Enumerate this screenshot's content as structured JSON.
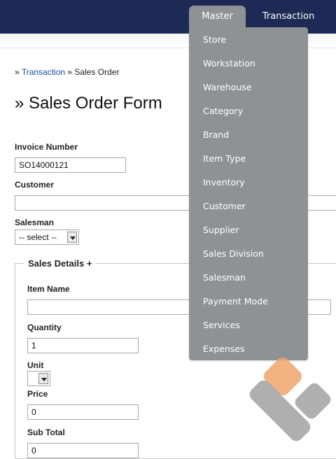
{
  "nav": {
    "master": "Master",
    "transaction": "Transaction"
  },
  "breadcrumb": {
    "sep": "»",
    "link": "Transaction",
    "current": "» Sales Order"
  },
  "page_title": "» Sales Order Form",
  "form": {
    "invoice_label": "Invoice Number",
    "invoice_value": "SO14000121",
    "customer_label": "Customer",
    "customer_value": "",
    "salesman_label": "Salesman",
    "salesman_selected": "-- select --"
  },
  "details": {
    "legend": "Sales Details +",
    "item_name_label": "Item Name",
    "item_name_value": "",
    "quantity_label": "Quantity",
    "quantity_value": "1",
    "unit_label": "Unit",
    "unit_selected": "",
    "price_label": "Price",
    "price_value": "0",
    "subtotal_label": "Sub Total",
    "subtotal_value": "0"
  },
  "master_menu": {
    "items": [
      "Store",
      "Workstation",
      "Warehouse",
      "Category",
      "Brand",
      "Item Type",
      "Inventory",
      "Customer",
      "Supplier",
      "Sales Division",
      "Salesman",
      "Payment Mode",
      "Services",
      "Expenses"
    ]
  },
  "colors": {
    "topbar": "#1c2a55",
    "menu": "#8f9294",
    "link": "#1b4ca0",
    "watermark_orange": "#f0a46c",
    "watermark_gray": "#a4a6a8"
  },
  "icons": {
    "watermark": "decorative-logo-icon"
  }
}
